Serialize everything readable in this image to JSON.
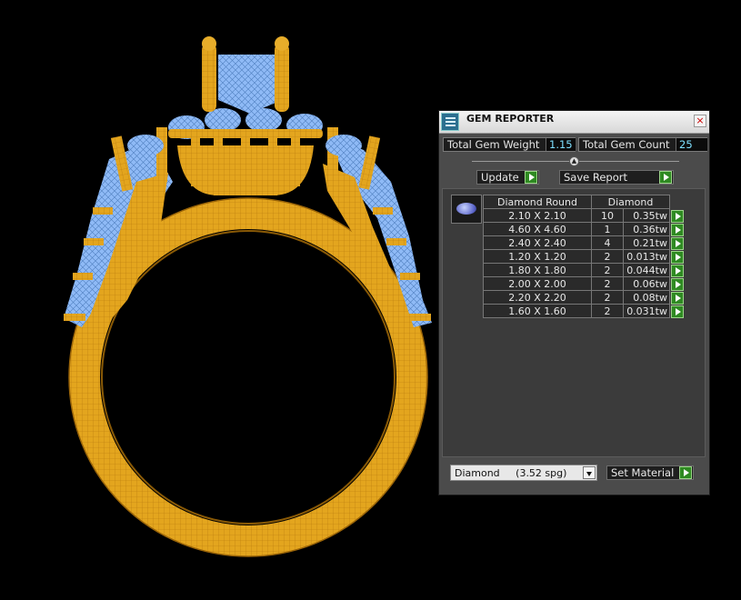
{
  "window": {
    "title": "GEM REPORTER",
    "close_glyph": "×"
  },
  "stats": {
    "weight_label": "Total Gem Weight",
    "weight_value": "1.15",
    "count_label": "Total Gem Count",
    "count_value": "25"
  },
  "actions": {
    "update_label": "Update",
    "save_label": "Save Report"
  },
  "table": {
    "headers": [
      "Diamond Round",
      "Diamond"
    ],
    "rows": [
      {
        "size": "2.10 X 2.10",
        "count": "10",
        "weight": "0.35tw"
      },
      {
        "size": "4.60 X 4.60",
        "count": "1",
        "weight": "0.36tw"
      },
      {
        "size": "2.40 X 2.40",
        "count": "4",
        "weight": "0.21tw"
      },
      {
        "size": "1.20 X 1.20",
        "count": "2",
        "weight": "0.013tw"
      },
      {
        "size": "1.80 X 1.80",
        "count": "2",
        "weight": "0.044tw"
      },
      {
        "size": "2.00 X 2.00",
        "count": "2",
        "weight": "0.06tw"
      },
      {
        "size": "2.20 X 2.20",
        "count": "2",
        "weight": "0.08tw"
      },
      {
        "size": "1.60 X 1.60",
        "count": "2",
        "weight": "0.031tw"
      }
    ]
  },
  "material": {
    "selected": "Diamond     (3.52 spg)",
    "set_label": "Set Material"
  },
  "icons": {
    "app": "gem-reporter-icon",
    "go": "green-play-arrow-icon",
    "gem": "round-gem-icon"
  },
  "colors": {
    "gold": "#e0a020",
    "gem_blue": "#86b8ff",
    "panel_bg": "#4b4b4b",
    "go_green": "#2f8a22",
    "value_cyan": "#7ee0ff"
  }
}
